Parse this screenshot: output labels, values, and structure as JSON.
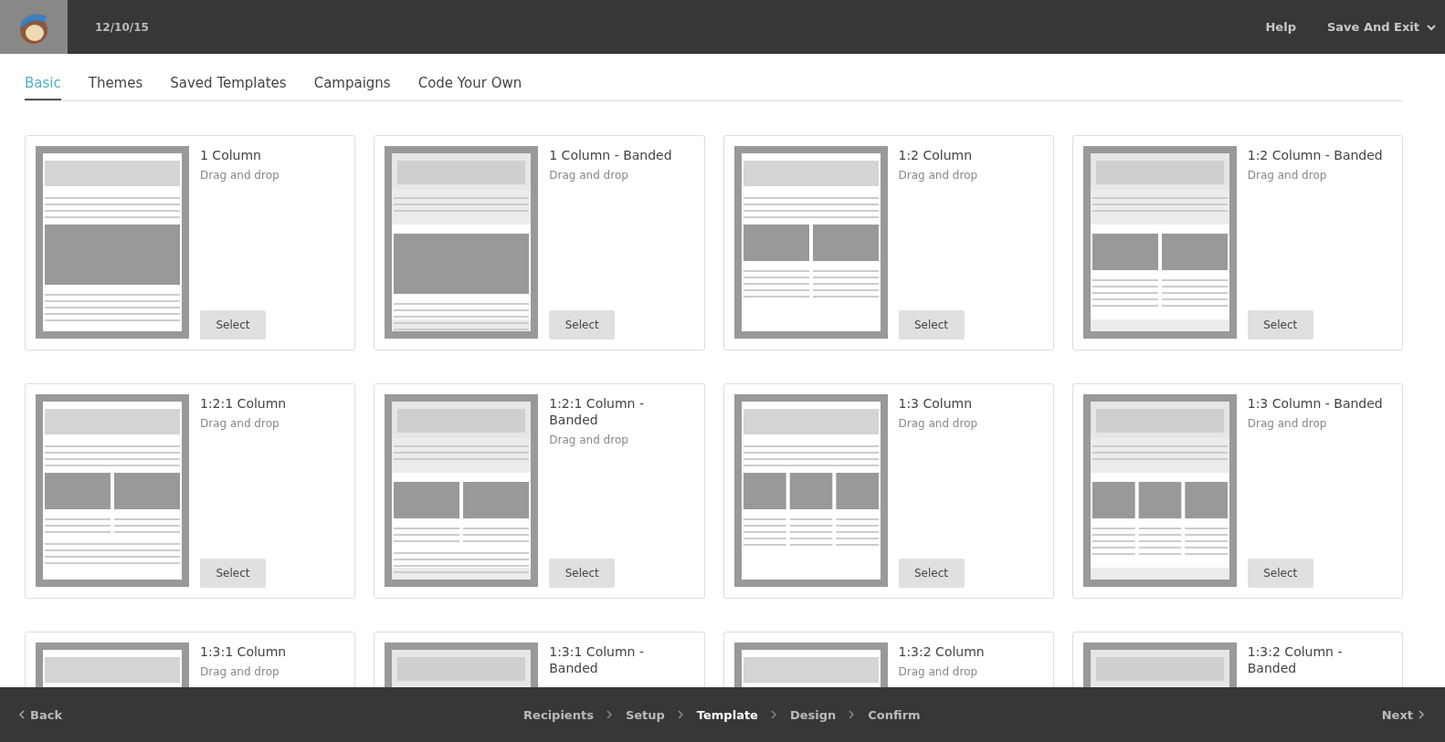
{
  "header": {
    "date": "12/10/15",
    "help": "Help",
    "save_exit": "Save And Exit"
  },
  "tabs": [
    {
      "label": "Basic",
      "selected": true
    },
    {
      "label": "Themes",
      "selected": false
    },
    {
      "label": "Saved Templates",
      "selected": false
    },
    {
      "label": "Campaigns",
      "selected": false
    },
    {
      "label": "Code Your Own",
      "selected": false
    }
  ],
  "templates": [
    {
      "title": "1 Column",
      "description": "Drag and drop",
      "kind": "one",
      "banded": false,
      "button": "Select"
    },
    {
      "title": "1 Column - Banded",
      "description": "Drag and drop",
      "kind": "one",
      "banded": true,
      "button": "Select"
    },
    {
      "title": "1:2 Column",
      "description": "Drag and drop",
      "kind": "two",
      "banded": false,
      "button": "Select"
    },
    {
      "title": "1:2 Column - Banded",
      "description": "Drag and drop",
      "kind": "two",
      "banded": true,
      "button": "Select"
    },
    {
      "title": "1:2:1 Column",
      "description": "Drag and drop",
      "kind": "two-one",
      "banded": false,
      "button": "Select"
    },
    {
      "title": "1:2:1 Column - Banded",
      "description": "Drag and drop",
      "kind": "two-one",
      "banded": true,
      "button": "Select"
    },
    {
      "title": "1:3 Column",
      "description": "Drag and drop",
      "kind": "three",
      "banded": false,
      "button": "Select"
    },
    {
      "title": "1:3 Column - Banded",
      "description": "Drag and drop",
      "kind": "three",
      "banded": true,
      "button": "Select"
    },
    {
      "title": "1:3:1 Column",
      "description": "Drag and drop",
      "kind": "three-one",
      "banded": false
    },
    {
      "title": "1:3:1 Column - Banded",
      "kind": "three-one",
      "banded": true
    },
    {
      "title": "1:3:2 Column",
      "description": "Drag and drop",
      "kind": "three-two",
      "banded": false
    },
    {
      "title": "1:3:2 Column - Banded",
      "kind": "three-two",
      "banded": true
    }
  ],
  "footer": {
    "back": "Back",
    "next": "Next",
    "steps": [
      {
        "label": "Recipients",
        "selected": false
      },
      {
        "label": "Setup",
        "selected": false
      },
      {
        "label": "Template",
        "selected": true
      },
      {
        "label": "Design",
        "selected": false
      },
      {
        "label": "Confirm",
        "selected": false
      }
    ]
  }
}
